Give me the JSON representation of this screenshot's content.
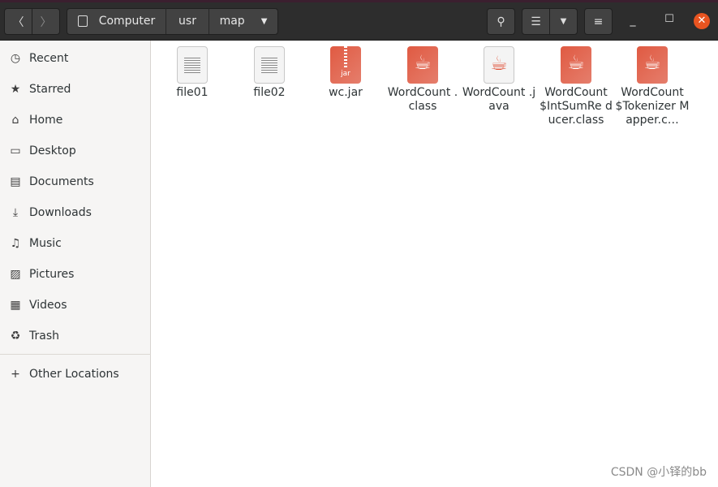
{
  "header": {
    "breadcrumb": [
      "Computer",
      "usr",
      "map"
    ]
  },
  "sidebar": {
    "items": [
      {
        "label": "Recent",
        "icon": "clock-icon"
      },
      {
        "label": "Starred",
        "icon": "star-icon"
      },
      {
        "label": "Home",
        "icon": "home-icon"
      },
      {
        "label": "Desktop",
        "icon": "desktop-icon"
      },
      {
        "label": "Documents",
        "icon": "document-icon"
      },
      {
        "label": "Downloads",
        "icon": "download-icon"
      },
      {
        "label": "Music",
        "icon": "music-icon"
      },
      {
        "label": "Pictures",
        "icon": "picture-icon"
      },
      {
        "label": "Videos",
        "icon": "video-icon"
      },
      {
        "label": "Trash",
        "icon": "trash-icon"
      }
    ],
    "other": "Other Locations"
  },
  "files": [
    {
      "name": "file01",
      "type": "text"
    },
    {
      "name": "file02",
      "type": "text"
    },
    {
      "name": "wc.jar",
      "type": "jar",
      "badge": "jar"
    },
    {
      "name": "WordCount .class",
      "type": "class"
    },
    {
      "name": "WordCount .java",
      "type": "java"
    },
    {
      "name": "WordCount $IntSumRe ducer.class",
      "type": "class"
    },
    {
      "name": "WordCount $Tokenizer Mapper.c…",
      "type": "class"
    }
  ],
  "watermark": "CSDN @小铎的bb",
  "colors": {
    "accent": "#e95420",
    "header": "#2d2d2d",
    "java_red": "#e05a42"
  }
}
